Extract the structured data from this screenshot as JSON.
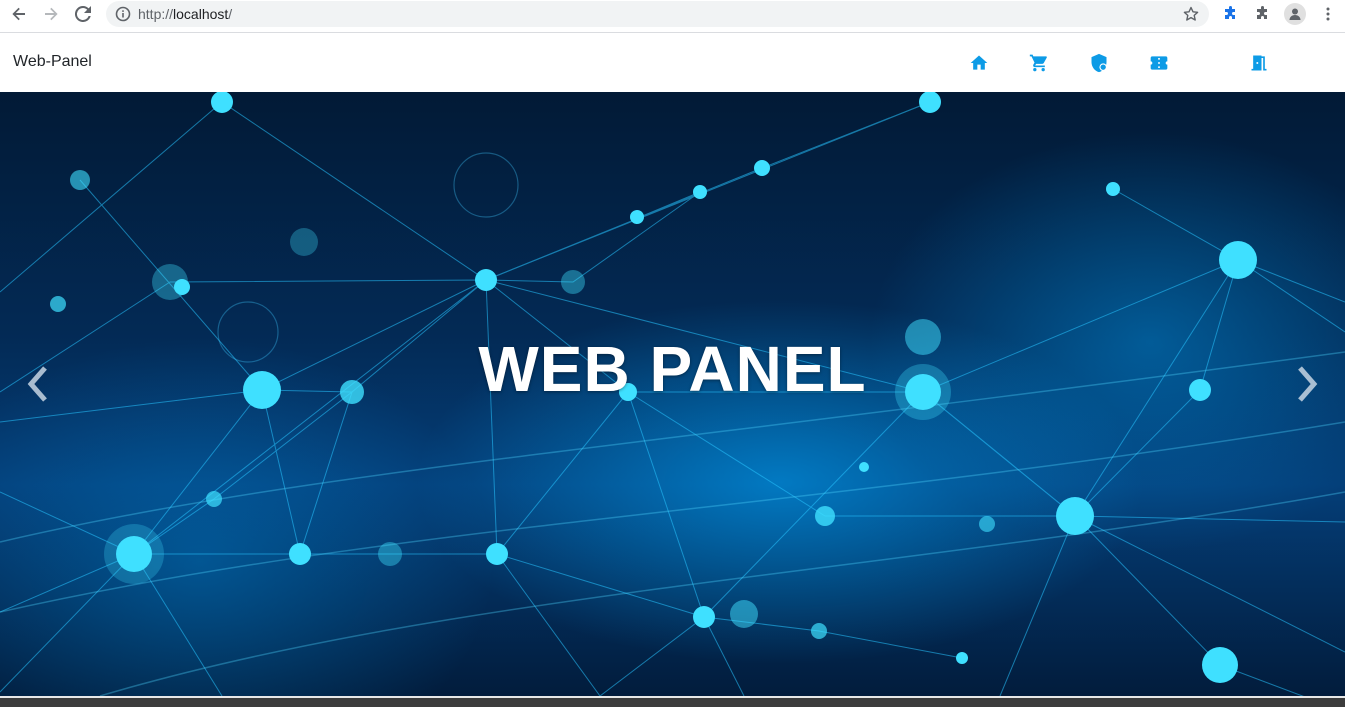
{
  "browser": {
    "url_protocol": "http://",
    "url_host": "localhost",
    "url_path": "/",
    "icons": [
      "back-icon",
      "forward-icon",
      "reload-icon",
      "info-icon",
      "star-icon",
      "extension-icon",
      "puzzle-icon",
      "profile-icon",
      "menu-icon"
    ]
  },
  "navbar": {
    "brand": "Web-Panel",
    "items": [
      {
        "name": "home",
        "icon": "home-icon"
      },
      {
        "name": "shop",
        "icon": "cart-icon"
      },
      {
        "name": "admin",
        "icon": "shield-icon"
      },
      {
        "name": "tickets",
        "icon": "ticket-icon"
      },
      {
        "name": "logout",
        "icon": "door-icon"
      }
    ],
    "accent_color": "#0d9be6"
  },
  "hero": {
    "title": "WEB PANEL",
    "prev_icon": "chevron-left-icon",
    "next_icon": "chevron-right-icon"
  }
}
